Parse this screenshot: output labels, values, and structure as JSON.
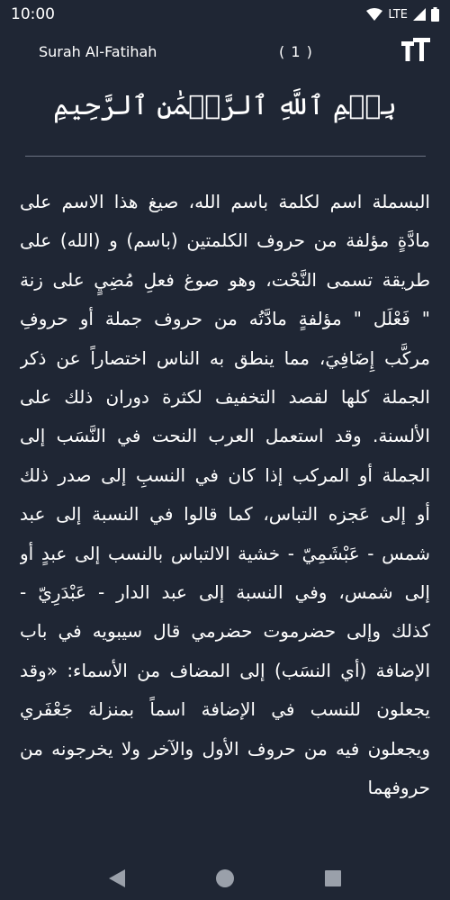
{
  "status_bar": {
    "time": "10:00",
    "network": "LTE",
    "icons": [
      "wifi-icon",
      "signal-icon",
      "battery-icon"
    ]
  },
  "app_bar": {
    "surah_name": "Surah Al-Fatihah",
    "ayah_number": "( 1 )",
    "font_size_icon": "text-size-icon"
  },
  "ayah": {
    "text": "بِسۡمِ ٱللَّهِ ٱلرَّحۡمَٰنِ ٱلرَّحِيمِ"
  },
  "tafsir": {
    "text": "البسملة اسم لكلمة باسم الله، صيغ هذا الاسم على مادَّةٍ مؤلفة من حروف الكلمتين (باسم) و (الله) على طريقة تسمى النَّحْت، وهو صوغ فعلِ مُضِيٍ على زنة \" فَعْلَل \" مؤلفةٍ مادَّتُه من حروف جملة أو حروفِ مركَّب إِضَافِيَ، مما ينطق به الناس اختصاراً عن ذكر الجملة كلها لقصد التخفيف لكثرة دوران ذلك على الألسنة. وقد استعمل العرب النحت في النَّسَب إلى الجملة أو المركب إذا كان في النسبِ إلى صدر ذلك أو إلى عَجزه التباس، كما قالوا في النسبة إلى عبد شمس - عَبْشَمِيّ - خشية الالتباس بالنسب إلى عبدٍ أو إلى شمس، وفي النسبة إلى عبد الدار - عَبْدَرِيّ - كذلك وإلى حضرموت حضرمي قال سيبويه في باب الإضافة (أي النسَب) إلى المضاف من الأسماء: «وقد يجعلون للنسب في الإضافة اسماً بمنزلة جَعْفَري ويجعلون فيه من حروف الأول والآخر ولا يخرجونه من حروفهما"
  },
  "nav_bar": {
    "buttons": [
      "back-icon",
      "home-icon",
      "recents-icon"
    ]
  }
}
